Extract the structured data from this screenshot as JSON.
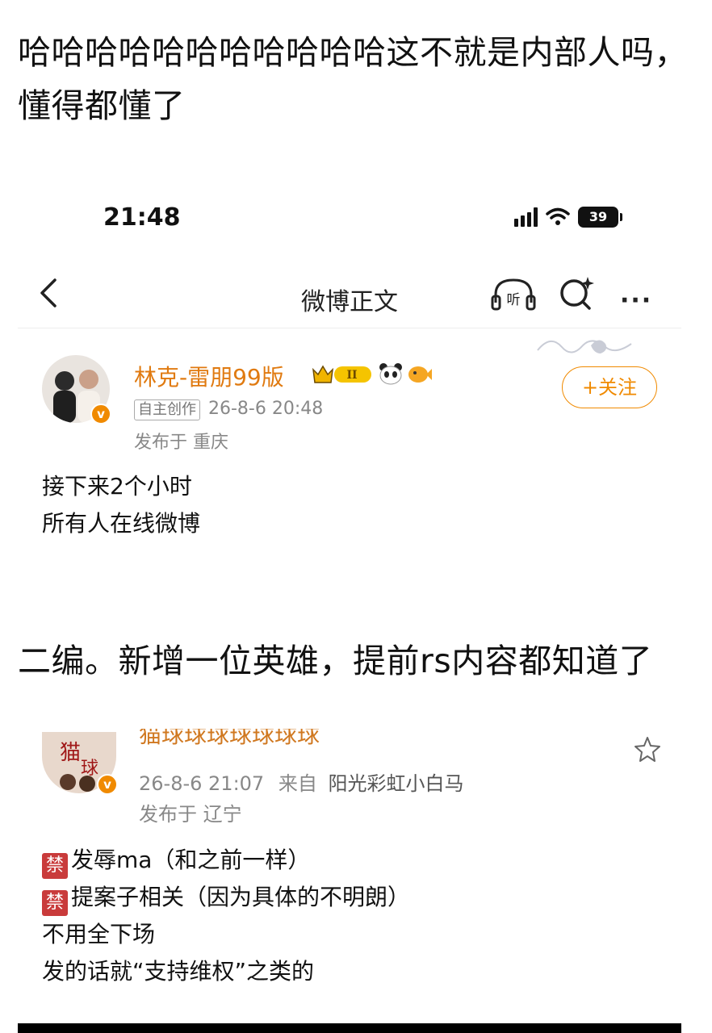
{
  "captions": {
    "top": "哈哈哈哈哈哈哈哈哈哈哈这不就是内部人吗，懂得都懂了",
    "middle": "二编。新增一位英雄，提前rs内容都知道了"
  },
  "status_bar": {
    "time": "21:48",
    "battery": "39"
  },
  "nav": {
    "title": "微博正文",
    "more": "···"
  },
  "post1": {
    "username": "林克-雷朋99版",
    "tag": "自主创作",
    "date": "26-8-6 20:48",
    "location": "发布于 重庆",
    "follow_label": "+关注",
    "lines": [
      "接下来2个小时",
      "所有人在线微博"
    ]
  },
  "post2": {
    "username": "猫球球球球球球球",
    "date": "26-8-6 21:07",
    "source_prefix": "来自",
    "source": "阳光彩虹小白马",
    "location": "发布于 辽宁",
    "ban_label": "禁",
    "lines": [
      "发辱ma（和之前一样）",
      "提案子相关（因为具体的不明朗）",
      "不用全下场",
      "发的话就“支持维权”之类的"
    ]
  },
  "colors": {
    "accent": "#f08a00",
    "ban": "#c93b3b"
  }
}
